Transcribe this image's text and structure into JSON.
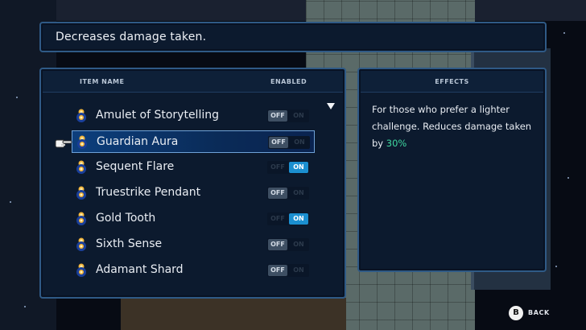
{
  "description": "Decreases damage taken.",
  "items_panel": {
    "header_name": "ITEM NAME",
    "header_enabled": "ENABLED"
  },
  "items": [
    {
      "label": "Amulet of Storytelling",
      "off_label": "OFF",
      "on_label": "ON",
      "enabled": false,
      "selected": false
    },
    {
      "label": "Guardian Aura",
      "off_label": "OFF",
      "on_label": "ON",
      "enabled": false,
      "selected": true
    },
    {
      "label": "Sequent Flare",
      "off_label": "OFF",
      "on_label": "ON",
      "enabled": true,
      "selected": false
    },
    {
      "label": "Truestrike Pendant",
      "off_label": "OFF",
      "on_label": "ON",
      "enabled": false,
      "selected": false
    },
    {
      "label": "Gold Tooth",
      "off_label": "OFF",
      "on_label": "ON",
      "enabled": true,
      "selected": false
    },
    {
      "label": "Sixth Sense",
      "off_label": "OFF",
      "on_label": "ON",
      "enabled": false,
      "selected": false
    },
    {
      "label": "Adamant Shard",
      "off_label": "OFF",
      "on_label": "ON",
      "enabled": false,
      "selected": false
    }
  ],
  "effects_panel": {
    "header": "EFFECTS",
    "text_before": "For those who prefer a lighter challenge. Reduces damage taken by ",
    "percent": "30%"
  },
  "back": {
    "button_glyph": "B",
    "label": "BACK"
  },
  "colors": {
    "panel_border": "#2f5a86",
    "toggle_on": "#1b8fd0",
    "percent_highlight": "#3fd8a0",
    "selection": "#0d3f7d"
  }
}
